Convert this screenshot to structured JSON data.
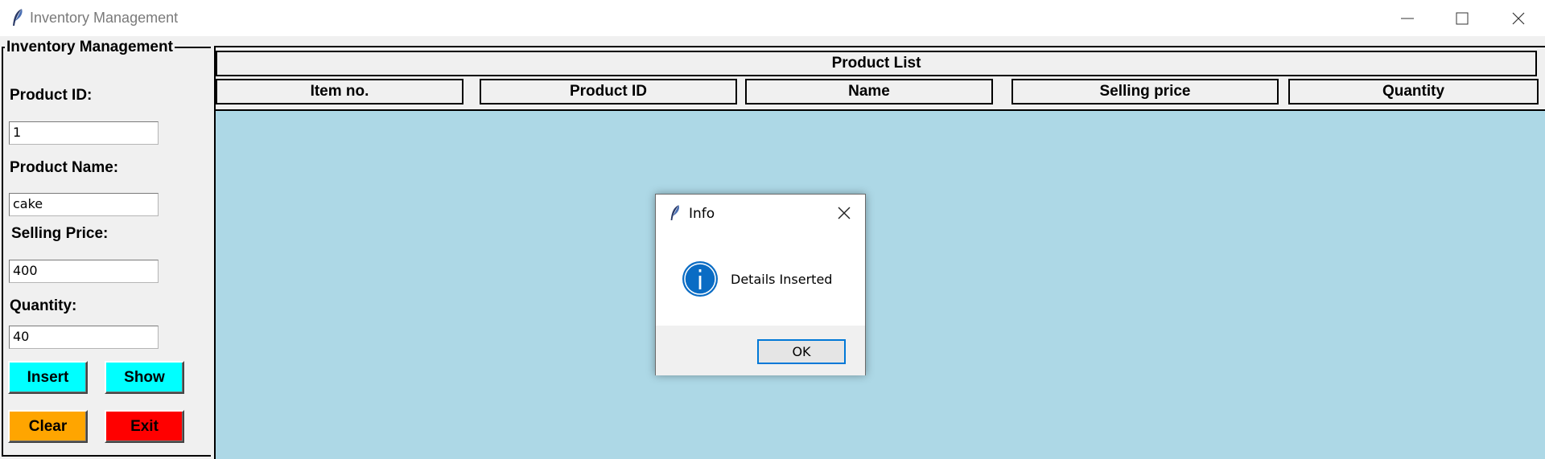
{
  "window": {
    "title": "Inventory Management",
    "icon": "feather-icon"
  },
  "form": {
    "group_title": "Inventory Management",
    "product_id_label": "Product ID:",
    "product_id_value": "1",
    "product_name_label": "Product Name:",
    "product_name_value": "cake",
    "selling_price_label": "Selling Price:",
    "selling_price_value": "400",
    "quantity_label": "Quantity:",
    "quantity_value": "40"
  },
  "buttons": {
    "insert": "Insert",
    "show": "Show",
    "clear": "Clear",
    "exit": "Exit"
  },
  "colors": {
    "insert_show": "#00ffff",
    "clear": "#ffa500",
    "exit": "#ff0000",
    "list_bg": "#add8e6",
    "dialog_accent": "#0078d7"
  },
  "table": {
    "title": "Product List",
    "columns": [
      "Item no.",
      "Product ID",
      "Name",
      "Selling price",
      "Quantity"
    ]
  },
  "dialog": {
    "title": "Info",
    "message": "Details Inserted",
    "ok_label": "OK",
    "icon": "info-icon"
  }
}
